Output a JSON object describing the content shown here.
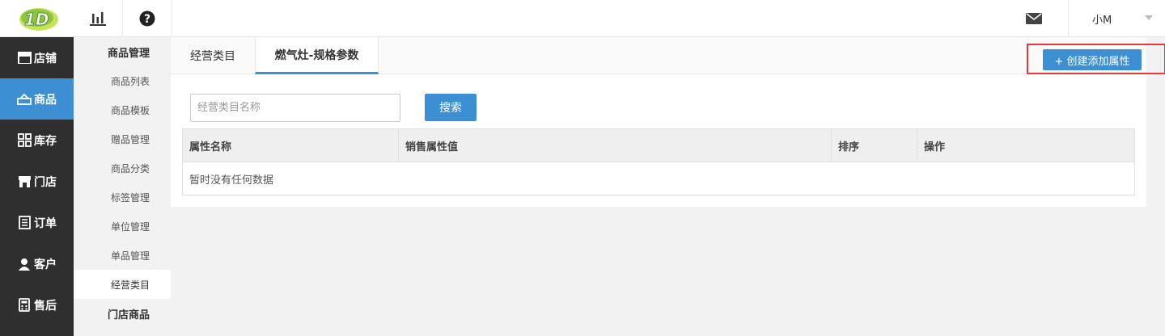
{
  "topbar": {
    "logo_text": "1D",
    "user_name": "小M"
  },
  "nav": {
    "items": [
      {
        "label": "店铺",
        "icon": "store-icon"
      },
      {
        "label": "商品",
        "icon": "goods-icon",
        "active": true
      },
      {
        "label": "库存",
        "icon": "grid-icon"
      },
      {
        "label": "门店",
        "icon": "shop-icon"
      },
      {
        "label": "订单",
        "icon": "order-icon"
      },
      {
        "label": "客户",
        "icon": "user-icon"
      },
      {
        "label": "售后",
        "icon": "calculator-icon"
      }
    ]
  },
  "subnav": {
    "head1": "商品管理",
    "items": [
      "商品列表",
      "商品模板",
      "赠品管理",
      "商品分类",
      "标签管理",
      "单位管理",
      "单品管理",
      "经营类目"
    ],
    "active_item": "经营类目",
    "head2": "门店商品"
  },
  "tabs": [
    "经营类目",
    "燃气灶-规格参数"
  ],
  "create_button": "+ 创建添加属性",
  "search": {
    "placeholder": "经营类目名称",
    "button": "搜索"
  },
  "table": {
    "columns": [
      "属性名称",
      "销售属性值",
      "排序",
      "操作"
    ],
    "empty_text": "暂时没有任何数据"
  },
  "colors": {
    "accent": "#3b8fd2",
    "nav_bg": "#2f2f2f",
    "highlight_border": "#e53935"
  }
}
